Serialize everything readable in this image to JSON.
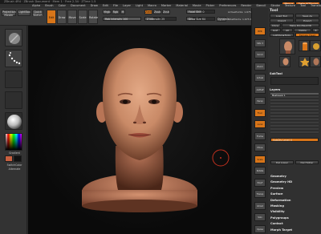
{
  "app": {
    "title": "ZBrush 4R4 · ZBrush Document · Mem 1 · Free 2.34 · ZTime 1.5",
    "menus": [
      "Alpha",
      "Brush",
      "Color",
      "Document",
      "Draw",
      "Edit",
      "File",
      "Layer",
      "Light",
      "Macro",
      "Marker",
      "Material",
      "Movie",
      "Picker",
      "Preferences",
      "Render",
      "Stencil",
      "Stroke",
      "Texture",
      "Tool",
      "Transform",
      "Zplugin",
      "Zscript"
    ],
    "quick_buttons": [
      "Menus",
      "DefaultZScript"
    ]
  },
  "top_shelf": {
    "projection_master": "Projection Master",
    "lightbox": "LightBox",
    "quick_sketch": "Quick Sketch",
    "edit": "Edit",
    "draw": "Draw",
    "move": "Move",
    "scale": "Scale",
    "rotate": "Rotate",
    "mrgb": "Mrgb",
    "rgb": "Rgb",
    "m": "M",
    "zadd": "Zadd",
    "zsub": "Zsub",
    "zcut": "Zcut",
    "focal_shift": {
      "label": "Focal Shift",
      "value": "0"
    },
    "draw_size": {
      "label": "Draw Size",
      "value": "64"
    },
    "rgb_intensity": {
      "label": "Rgb Intensity",
      "value": "100"
    },
    "z_intensity": {
      "label": "Z Intensity",
      "value": "25"
    },
    "active_points": "ActivePoints: 1.675 Mil",
    "total_points": "TotalPoints: 1.675 Mil",
    "dynamic": "Dynamic"
  },
  "left_shelf": {
    "gradient_label": "Gradient",
    "switch_color_label": "SwitchColor",
    "alternate_label": "Alternate"
  },
  "right_column": [
    "BPR",
    "SPix 3",
    "Scroll",
    "Zoom",
    "Actual",
    "AAHalf",
    "Persp",
    "Floor",
    "Local",
    "Frame",
    "Move",
    "Scale",
    "Rotate",
    "PolyF",
    "Transp",
    "Ghost",
    "Solo",
    "Xpose"
  ],
  "tool_panel": {
    "header": "Tool",
    "load_tool": "Load Tool",
    "save_as": "Save As",
    "import": "Import",
    "export": "Export",
    "clone": "Clone",
    "make_polymesh": "Make PolyMesh3D",
    "goz": "GoZ",
    "all": "All",
    "visible": "Visible",
    "r": "R",
    "lightbox_tools": "Lightbox▸Tools",
    "current_tool": "Female_Head",
    "tool_thumbs": [
      "Female_Head",
      "Cylinder3D",
      "SimpleBrush",
      "Female_Head"
    ],
    "subtool_header": "SubTool",
    "layers_header": "Layers",
    "layer_name": "MeshLayer 1",
    "subdiv_label": "SubDiv Level",
    "subdiv_value": "4",
    "del_lower": "Del Lower",
    "del_higher": "Del Higher",
    "sections": [
      "Geometry",
      "Geometry HD",
      "Preview",
      "Surface",
      "Deformation",
      "Masking",
      "Visibility",
      "Polygroups",
      "Contact",
      "Morph Target",
      "Polypaint"
    ]
  },
  "colors": {
    "accent": "#d87519",
    "skin": "#c98a67",
    "background": "#0c0c0c"
  }
}
